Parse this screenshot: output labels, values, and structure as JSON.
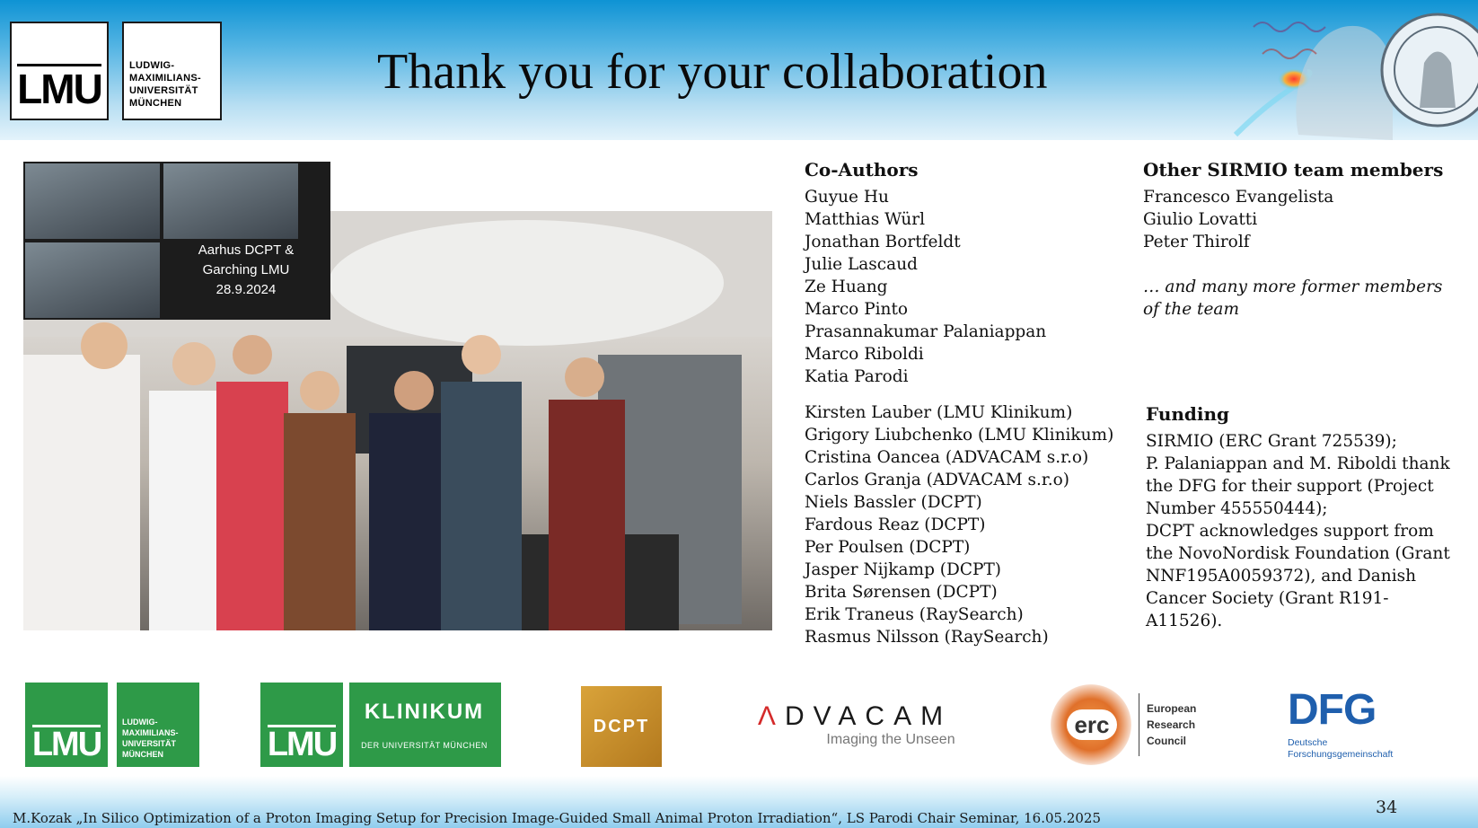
{
  "header": {
    "logo_lmu": "LMU",
    "logo_name_lines": [
      "LUDWIG-",
      "MAXIMILIANS-",
      "UNIVERSITÄT",
      "MÜNCHEN"
    ],
    "title": "Thank you for your collaboration"
  },
  "photo": {
    "caption_lines": [
      "Aarhus DCPT &",
      "Garching LMU",
      "28.9.2024"
    ]
  },
  "coauthors": {
    "heading": "Co-Authors",
    "names": [
      "Guyue Hu",
      "Matthias Würl",
      "Jonathan Bortfeldt",
      "Julie Lascaud",
      "Ze Huang",
      "Marco Pinto",
      "Prasannakumar Palaniappan",
      "Marco Riboldi",
      "Katia Parodi"
    ],
    "external": [
      "Kirsten Lauber (LMU Klinikum)",
      "Grigory Liubchenko (LMU Klinikum)",
      "Cristina Oancea (ADVACAM s.r.o)",
      "Carlos Granja (ADVACAM s.r.o)",
      "Niels Bassler (DCPT)",
      "Fardous Reaz (DCPT)",
      "Per Poulsen (DCPT)",
      "Jasper Nijkamp (DCPT)",
      "Brita Sørensen (DCPT)",
      "Erik Traneus (RaySearch)",
      "Rasmus Nilsson (RaySearch)"
    ]
  },
  "team": {
    "heading": "Other SIRMIO team members",
    "names": [
      "Francesco Evangelista",
      "Giulio Lovatti",
      "Peter Thirolf"
    ],
    "note_lines": [
      "… and many more former members",
      "of the team"
    ]
  },
  "funding": {
    "heading": "Funding",
    "lines": [
      "SIRMIO (ERC Grant 725539);",
      "P. Palaniappan and M. Riboldi thank",
      "the DFG for their support (Project",
      "Number 455550444);",
      "DCPT acknowledges support from",
      "the NovoNordisk Foundation (Grant",
      "NNF195A0059372), and Danish",
      "Cancer Society (Grant R191-",
      "A11526)."
    ]
  },
  "partner_logos": {
    "lmu": {
      "mark": "LMU",
      "name_lines": [
        "LUDWIG-",
        "MAXIMILIANS-",
        "UNIVERSITÄT",
        "MÜNCHEN"
      ]
    },
    "klinikum": {
      "mark": "LMU",
      "name": "KLINIKUM",
      "sub": "DER UNIVERSITÄT MÜNCHEN"
    },
    "dcpt": "DCPT",
    "advacam": {
      "name": "ADVACAM",
      "tagline": "Imaging the Unseen"
    },
    "erc": {
      "mark": "erc",
      "name_lines": [
        "European",
        "Research",
        "Council"
      ]
    },
    "dfg": {
      "mark": "DFG",
      "name_lines": [
        "Deutsche",
        "Forschungsgemeinschaft"
      ]
    }
  },
  "colors": {
    "lmu_green": "#2e9a48",
    "dcpt_gold": "#c8922a",
    "advacam_red": "#d42a2a",
    "erc_orange": "#e0702a",
    "dfg_blue": "#1f5fad"
  },
  "footer": {
    "text": "M.Kozak „In Silico Optimization of a Proton Imaging Setup for Precision Image-Guided Small Animal Proton Irradiation“,  LS Parodi Chair Seminar, 16.05.2025",
    "page": "34"
  }
}
